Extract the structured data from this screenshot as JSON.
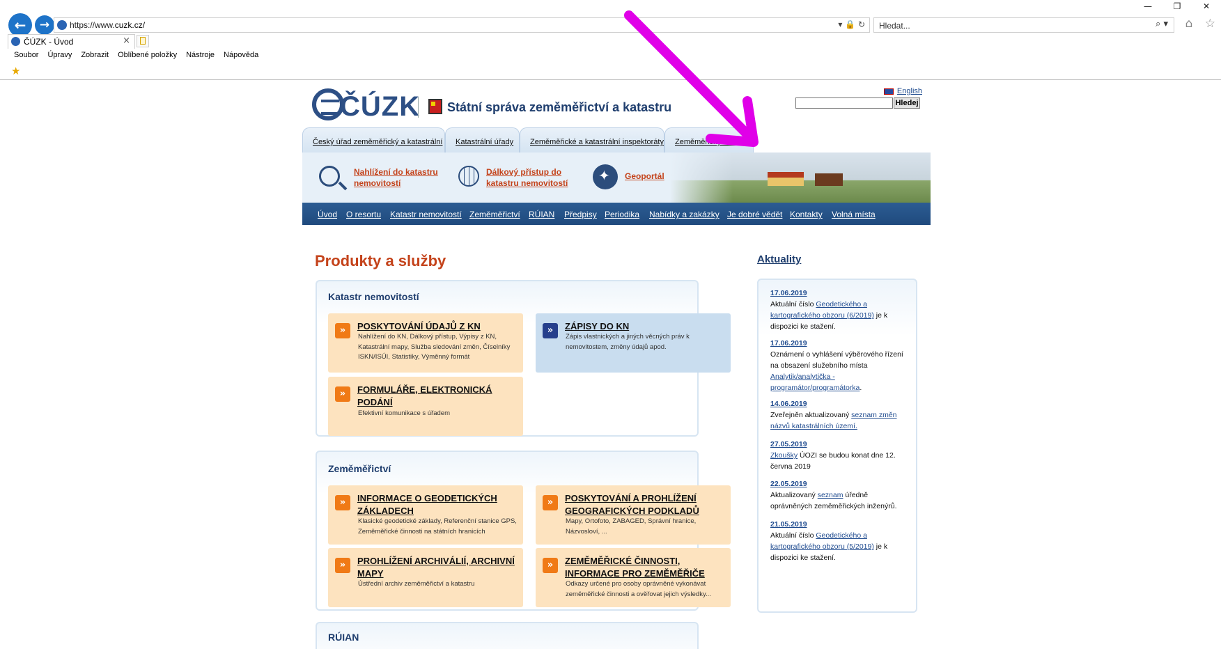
{
  "browser": {
    "url_prefix": "https://www.",
    "url_host": "cuzk.cz/",
    "search_placeholder": "Hledat...",
    "tab_title": "ČÚZK - Úvod",
    "tab_close": "×",
    "back_icon": "←",
    "forward_icon": "→",
    "addr_tools": "▾ 🔒 ↻",
    "search_tools": "⌕ ▾",
    "win_ctrls": [
      "—",
      "❐",
      "✕"
    ],
    "right_icons": "⌂ ☆",
    "menu": [
      "Soubor",
      "Úpravy",
      "Zobrazit",
      "Oblíbené položky",
      "Nástroje",
      "Nápověda"
    ],
    "fav_star": "★"
  },
  "header": {
    "logo_text": "ČÚZK",
    "site_title": "Státní správa zeměměřictví a katastru",
    "lang_link": "English",
    "search_button": "Hledej"
  },
  "org_tabs": [
    "Český úřad zeměměřický a katastrální",
    "Katastrální úřady",
    "Zeměměřické a katastrální inspektoráty",
    "Zeměměřický úřad"
  ],
  "quick_links": [
    "Nahlížení do katastru nemovitostí",
    "Dálkový přístup do katastru nemovitostí",
    "Geoportál"
  ],
  "main_nav": [
    "Úvod",
    "O resortu",
    "Katastr nemovitostí",
    "Zeměměřictví",
    "RÚIAN",
    "Předpisy",
    "Periodika",
    "Nabídky a zakázky",
    "Je dobré vědět",
    "Kontakty",
    "Volná místa"
  ],
  "products": {
    "title": "Produkty a služby",
    "arrow_glyph": "»",
    "sections": [
      {
        "title": "Katastr nemovitostí",
        "cards": [
          {
            "title": "Poskytování údajů z KN",
            "desc": "Nahlížení do KN, Dálkový přístup, Výpisy z KN, Katastrální mapy, Služba sledování změn, Číselníky ISKN/ISÚI, Statistiky, Výměnný formát"
          },
          {
            "title": "Zápisy do KN",
            "desc": "Zápis vlastnických a jiných věcných práv k nemovitostem, změny údajů apod."
          },
          {
            "title": "Formuláře, elektronická podání",
            "desc": "Efektivní komunikace s úřadem"
          }
        ]
      },
      {
        "title": "Zeměměřictví",
        "cards": [
          {
            "title": "Informace o geodetických základech",
            "desc": "Klasické geodetické základy, Referenční stanice GPS, Zeměměřické činnosti na státních hranicích"
          },
          {
            "title": "Poskytování a prohlížení geografických podkladů",
            "desc": "Mapy, Ortofoto, ZABAGED, Správní hranice, Názvosloví, ..."
          },
          {
            "title": "Prohlížení archiválií, archivní mapy",
            "desc": "Ústřední archiv zeměměřictví a katastru"
          },
          {
            "title": "Zeměměřické činnosti, informace pro zeměměřiče",
            "desc": "Odkazy určené pro osoby oprávněné vykonávat zeměměřické činnosti a ověřovat jejich výsledky..."
          }
        ]
      },
      {
        "title": "RÚIAN"
      }
    ]
  },
  "news": {
    "title": "Aktuality",
    "items": [
      {
        "date": "17.06.2019",
        "pre": "Aktuální číslo ",
        "link": "Geodetického a kartografického obzoru (6/2019)",
        "post": " je k dispozici ke stažení."
      },
      {
        "date": "17.06.2019",
        "pre": "Oznámení o vyhlášení výběrového řízení na obsazení služebního místa ",
        "link": "Analytik/analytička - programátor/programátorka",
        "post": "."
      },
      {
        "date": "14.06.2019",
        "pre": "Zveřejněn aktualizovaný ",
        "link": "seznam změn názvů katastrálních území.",
        "post": ""
      },
      {
        "date": "27.05.2019",
        "pre": "",
        "link": "Zkoušky",
        "post": " ÚOZI se budou konat dne 12. června 2019"
      },
      {
        "date": "22.05.2019",
        "pre": "Aktualizovaný ",
        "link": "seznam",
        "post": " úředně oprávněných zeměměřických inženýrů."
      },
      {
        "date": "21.05.2019",
        "pre": "Aktuální číslo ",
        "link": "Geodetického a kartografického obzoru (5/2019)",
        "post": " je k dispozici ke stažení."
      }
    ]
  },
  "colors": {
    "annotation_arrow": "#e000e8",
    "accent_orange": "#c4431b",
    "navy": "#1f3e6e"
  }
}
